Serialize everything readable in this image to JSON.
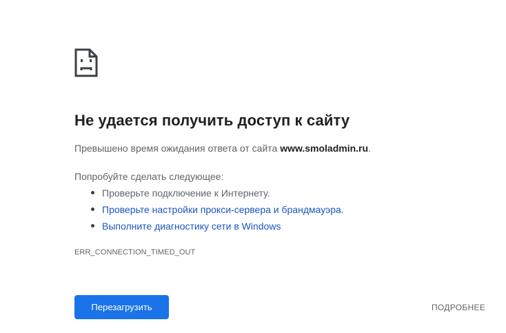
{
  "icon": "sad-page-icon",
  "title": "Не удается получить доступ к сайту",
  "summary": {
    "prefix": "Превышено время ожидания ответа от сайта ",
    "host": "www.smoladmin.ru",
    "suffix": "."
  },
  "suggestions": {
    "heading": "Попробуйте сделать следующее:",
    "items": [
      "Проверьте подключение к Интернету.",
      "Проверьте настройки прокси-сервера и брандмауэра.",
      "Выполните диагностику сети в Windows"
    ]
  },
  "error_code": "ERR_CONNECTION_TIMED_OUT",
  "buttons": {
    "reload": "Перезагрузить",
    "details": "ПОДРОБНЕЕ"
  },
  "colors": {
    "accent": "#1a73e8",
    "link": "#1a56c0",
    "title": "#202124",
    "text": "#5f6368"
  }
}
